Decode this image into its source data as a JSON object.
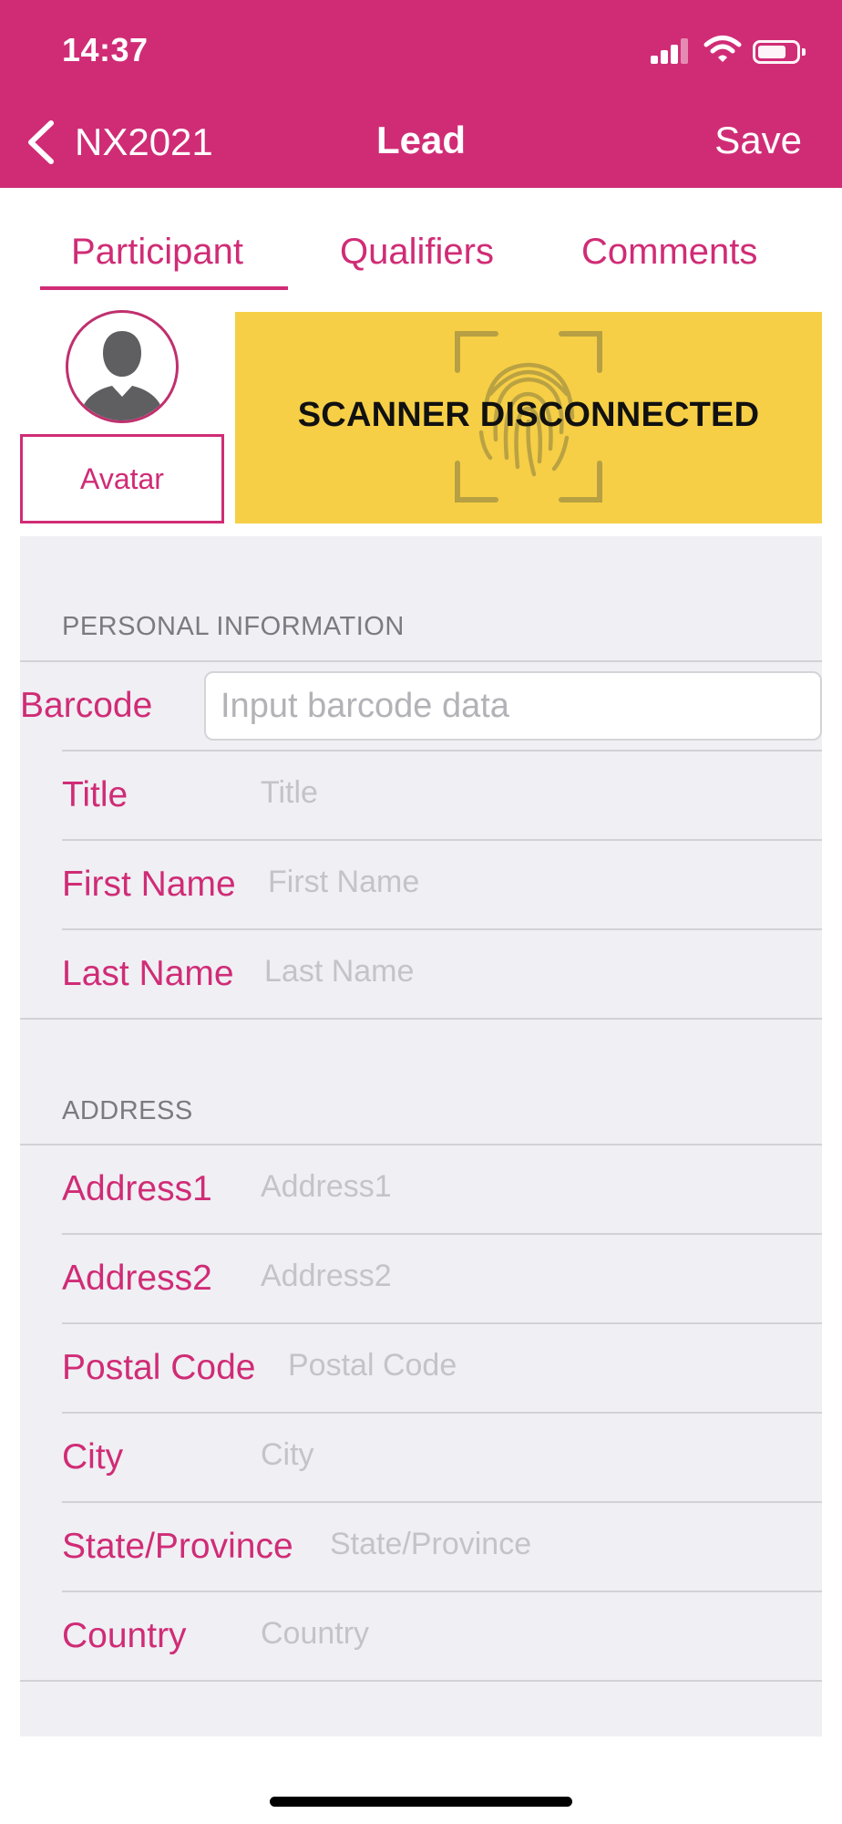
{
  "status_bar": {
    "time": "14:37"
  },
  "nav": {
    "back_label": "NX2021",
    "title": "Lead",
    "save_label": "Save"
  },
  "tabs": [
    {
      "label": "Participant",
      "selected": true
    },
    {
      "label": "Qualifiers",
      "selected": false
    },
    {
      "label": "Comments",
      "selected": false
    }
  ],
  "avatar": {
    "button_label": "Avatar"
  },
  "scanner": {
    "status_text": "SCANNER DISCONNECTED",
    "background_color": "#f6cf46"
  },
  "personal": {
    "header": "PERSONAL INFORMATION",
    "barcode": {
      "label": "Barcode",
      "placeholder": "Input barcode data"
    },
    "fields": [
      {
        "label": "Title",
        "placeholder": "Title"
      },
      {
        "label": "First Name",
        "placeholder": "First Name"
      },
      {
        "label": "Last Name",
        "placeholder": "Last Name"
      }
    ]
  },
  "address": {
    "header": "ADDRESS",
    "fields": [
      {
        "label": "Address1",
        "placeholder": "Address1"
      },
      {
        "label": "Address2",
        "placeholder": "Address2"
      },
      {
        "label": "Postal Code",
        "placeholder": "Postal Code"
      },
      {
        "label": "City",
        "placeholder": "City"
      },
      {
        "label": "State/Province",
        "placeholder": "State/Province"
      },
      {
        "label": "Country",
        "placeholder": "Country"
      }
    ]
  },
  "colors": {
    "accent": "#d02c76",
    "panel_background": "#efeff4",
    "placeholder": "#c4c4c8"
  }
}
